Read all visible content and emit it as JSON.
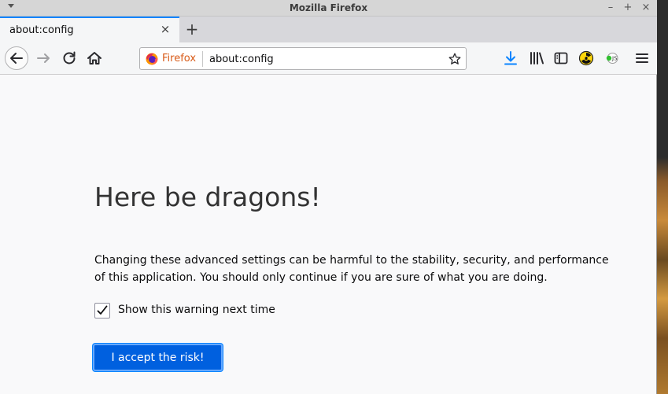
{
  "window": {
    "title": "Mozilla Firefox",
    "minimize_glyph": "–",
    "maximize_glyph": "+",
    "close_glyph": "×"
  },
  "tabs": [
    {
      "label": "about:config",
      "active": true
    }
  ],
  "newtab": {
    "glyph": "+"
  },
  "tab_close_glyph": "×",
  "urlbar": {
    "identity_label": "Firefox",
    "url": "about:config"
  },
  "toolbar": {
    "icons": [
      "back-icon",
      "forward-icon",
      "reload-icon",
      "home-icon",
      "bookmark-star-icon",
      "downloads-icon",
      "library-icon",
      "sidebar-icon",
      "radiation-extension-icon",
      "js-extension-icon",
      "hamburger-menu-icon"
    ]
  },
  "page": {
    "heading": "Here be dragons!",
    "warning": "Changing these advanced settings can be harmful to the stability, security, and performance of this application. You should only continue if you are sure of what you are doing.",
    "checkbox_label": "Show this warning next time",
    "checkbox_checked": true,
    "accept_button": "I accept the risk!"
  },
  "colors": {
    "accent": "#0a84ff",
    "button": "#0060df",
    "identity": "#d85a17",
    "download": "#0a84ff"
  }
}
